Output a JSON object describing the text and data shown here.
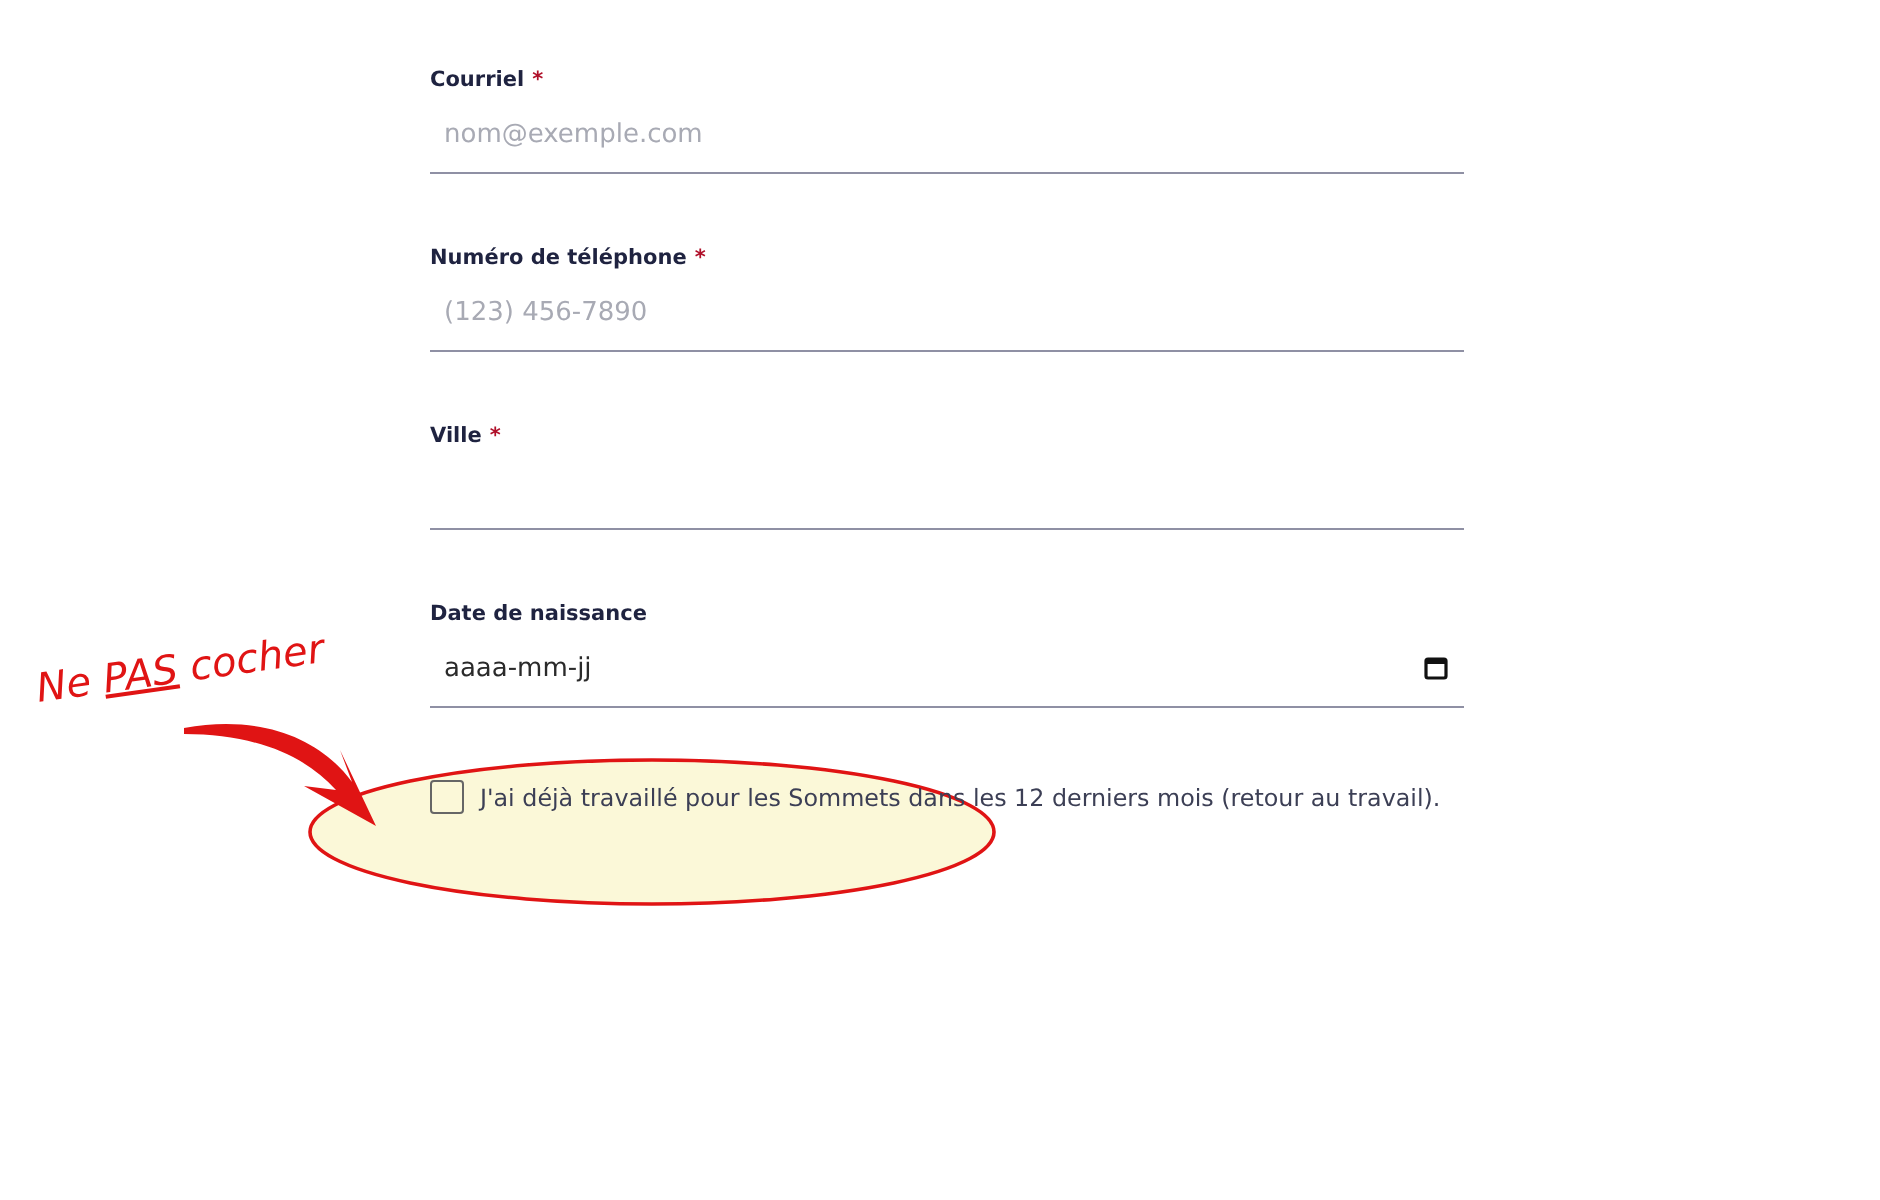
{
  "form": {
    "fields": [
      {
        "kind": "text",
        "label": "Courriel",
        "required_mark": "*",
        "placeholder": "nom@exemple.com"
      },
      {
        "kind": "text",
        "label": "Numéro de téléphone",
        "required_mark": "*",
        "placeholder": "(123) 456-7890"
      },
      {
        "kind": "text",
        "label": "Ville",
        "required_mark": "*"
      },
      {
        "kind": "date",
        "label": "Date de naissance",
        "placeholder": "aaaa-mm-jj"
      }
    ],
    "checkbox": {
      "label": "J'ai déjà travaillé pour les Sommets dans les 12 derniers mois (retour au travail).",
      "checked": false
    }
  },
  "annotation": {
    "lead": "Ne",
    "underlined": "PAS",
    "tail": "cocher"
  }
}
